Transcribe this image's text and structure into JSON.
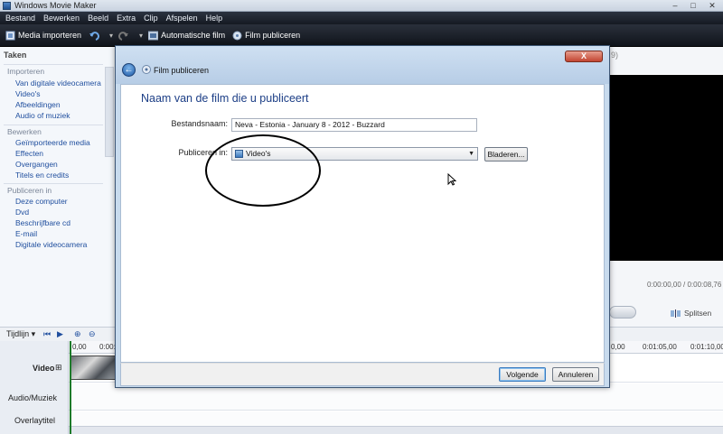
{
  "window": {
    "title": "Windows Movie Maker",
    "minimize": "–",
    "maximize": "□",
    "close": "✕"
  },
  "menu": [
    "Bestand",
    "Bewerken",
    "Beeld",
    "Extra",
    "Clip",
    "Afspelen",
    "Help"
  ],
  "toolbar": {
    "import_label": "Media importeren",
    "undo_arrow": "▾",
    "redo_arrow": "▾",
    "automovie_label": "Automatische film",
    "publish_label": "Film publiceren"
  },
  "taskpane": {
    "title": "Taken",
    "sections": [
      {
        "name": "Importeren",
        "items": [
          "Van digitale videocamera",
          "Video's",
          "Afbeeldingen",
          "Audio of muziek"
        ]
      },
      {
        "name": "Bewerken",
        "items": [
          "Geïmporteerde media",
          "Effecten",
          "Overgangen",
          "Titels en credits"
        ]
      },
      {
        "name": "Publiceren in",
        "items": [
          "Deze computer",
          "Dvd",
          "Beschrijfbare cd",
          "E-mail",
          "Digitale videocamera"
        ]
      }
    ]
  },
  "preview": {
    "header_fragment": "9)",
    "time": "0:00:00,00 / 0:00:08,76",
    "split_label": "Splitsen"
  },
  "timeline": {
    "label": "Tijdlijn",
    "ticks": [
      "0,00",
      "0:00:",
      "0,00",
      "0:01:05,00",
      "0:01:10,00"
    ],
    "tracks": {
      "video": "Video",
      "audio": "Audio/Muziek",
      "overlay": "Overlaytitel"
    },
    "expand": "⊞"
  },
  "dialog": {
    "title": "Film publiceren",
    "close": "X",
    "heading": "Naam van de film die u publiceert",
    "filename_label": "Bestandsnaam:",
    "filename_value": "Neva - Estonia - January 8 - 2012 - Buzzard",
    "publish_in_label": "Publiceren in:",
    "publish_in_value": "Video's",
    "browse_label": "Bladeren...",
    "next_label": "Volgende",
    "cancel_label": "Annuleren"
  }
}
